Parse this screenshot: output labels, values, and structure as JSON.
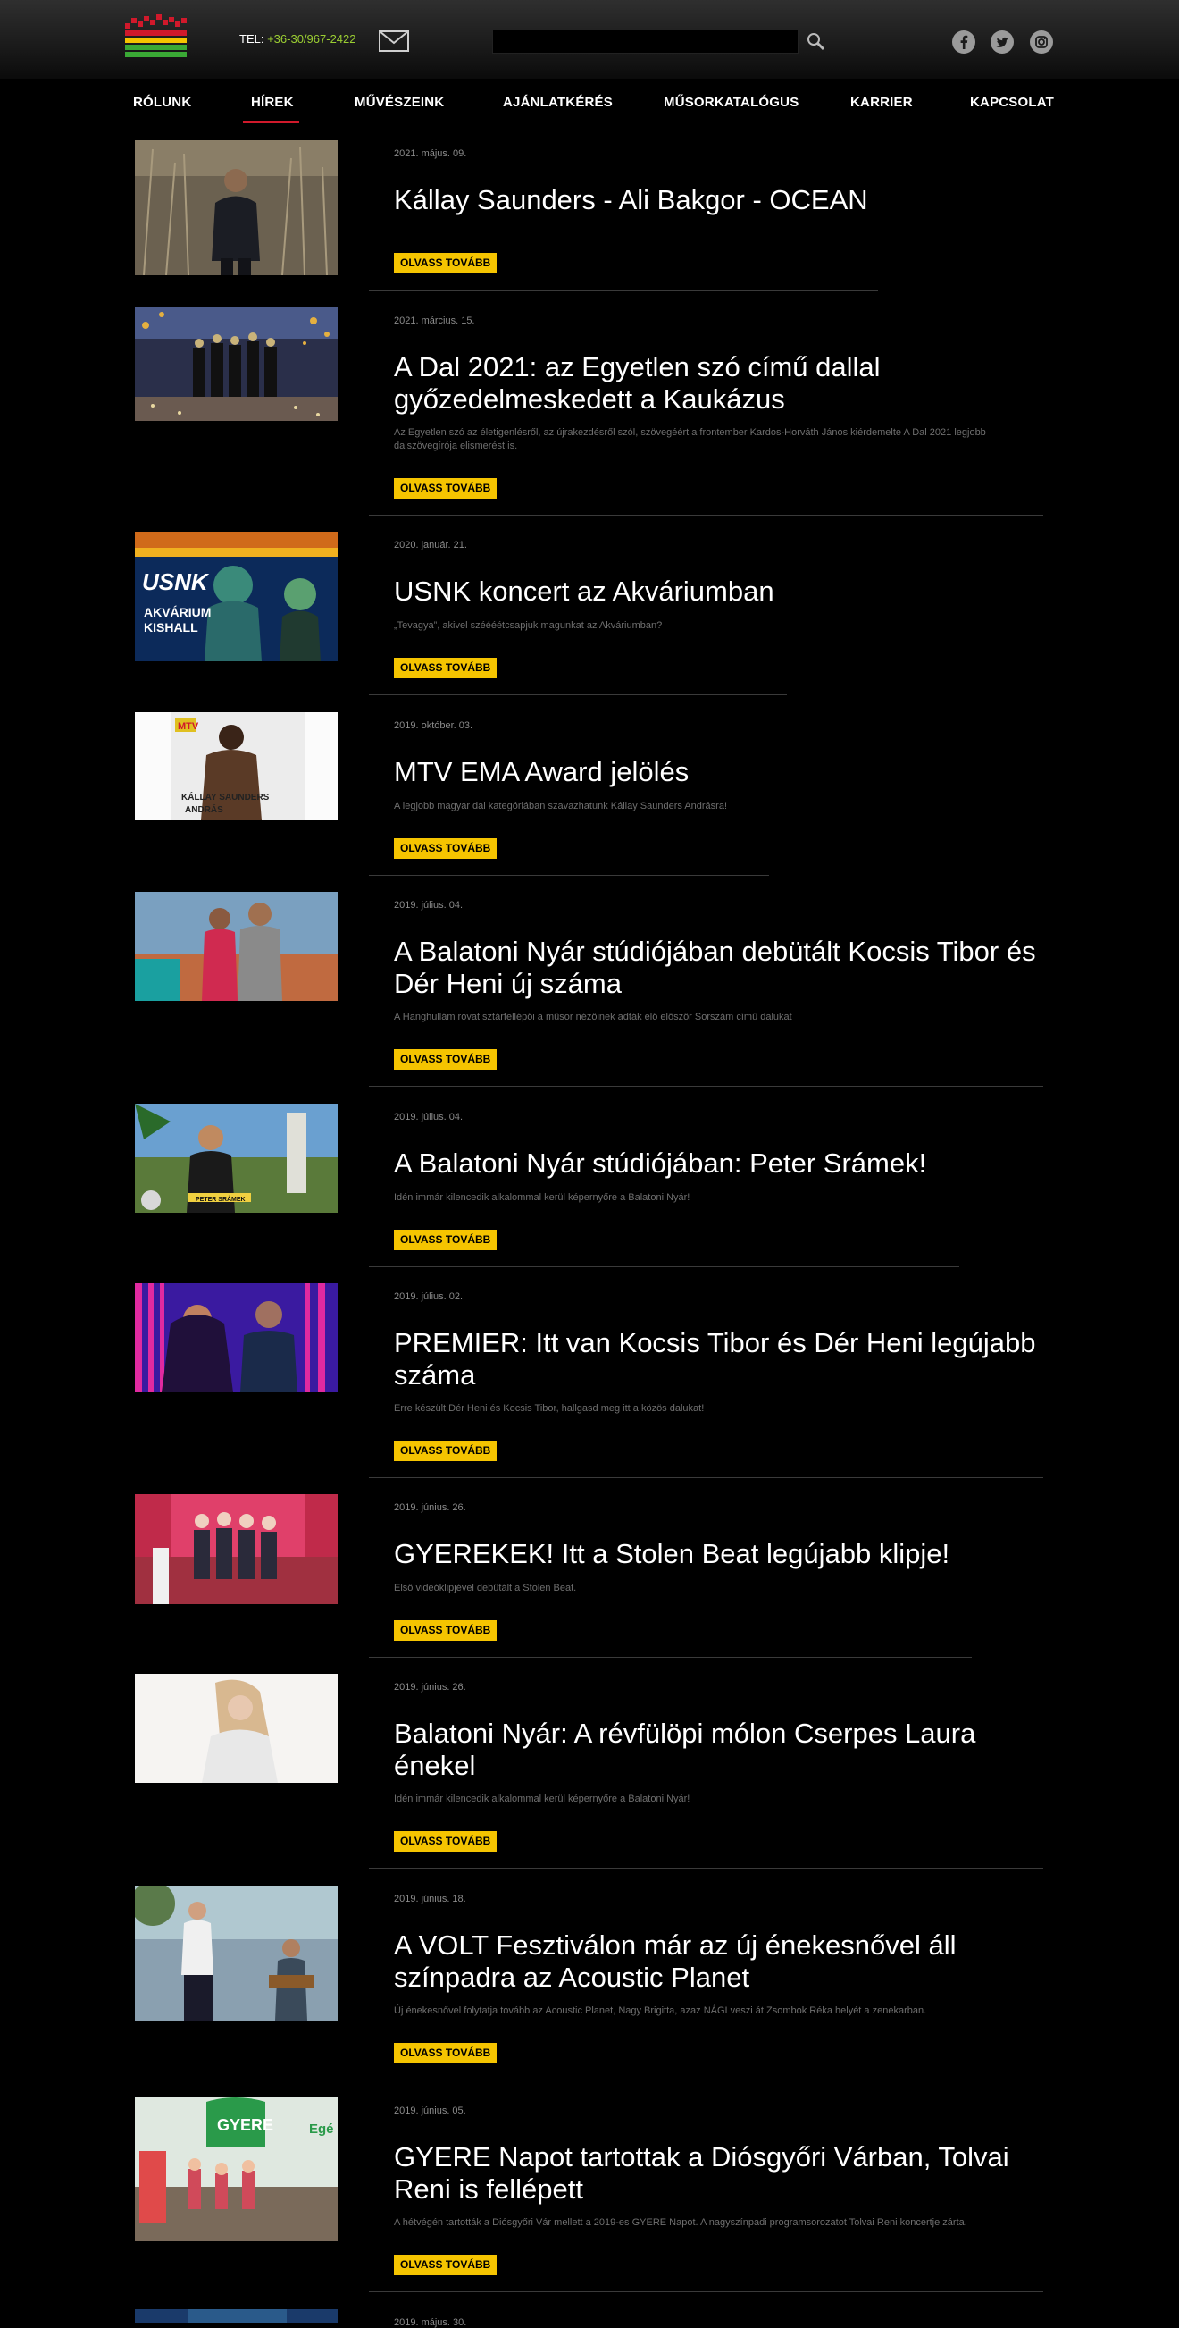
{
  "header": {
    "phone_label": "TEL:",
    "phone_number": "+36-30/967-2422",
    "search_value": ""
  },
  "nav": [
    "RÓLUNK",
    "HÍREK",
    "MŰVÉSZEINK",
    "AJÁNLATKÉRÉS",
    "MŰSORKATALÓGUS",
    "KARRIER",
    "KAPCSOLAT"
  ],
  "read_more": "OLVASS TOVÁBB",
  "colors": {
    "accent": "#f5c400",
    "nav_active": "#d0192b",
    "phone": "#9acd32"
  },
  "articles": [
    {
      "date": "2021. május. 09.",
      "title": "Kállay Saunders - Ali Bakgor - OCEAN",
      "excerpt": ""
    },
    {
      "date": "2021. március. 15.",
      "title": "A Dal 2021: az Egyetlen szó című dallal győzedelmeskedett a Kaukázus",
      "excerpt": "Az Egyetlen szó az életigenlésről, az újrakezdésről szól, szövegéért a frontember Kardos-Horváth János kiérdemelte A Dal 2021 legjobb dalszövegírója elismerést is."
    },
    {
      "date": "2020. január. 21.",
      "title": "USNK koncert az Akváriumban",
      "excerpt": "„Tevagya”, akivel széééétcsapjuk magunkat az Akváriumban?"
    },
    {
      "date": "2019. október. 03.",
      "title": "MTV EMA Award jelölés",
      "excerpt": "A legjobb magyar dal kategóriában szavazhatunk Kállay Saunders Andrásra!"
    },
    {
      "date": "2019. július. 04.",
      "title": "A Balatoni Nyár stúdiójában debütált Kocsis Tibor és Dér Heni új száma",
      "excerpt": "A Hanghullám rovat sztárfellépői a műsor nézőinek adták elő először Sorszám című dalukat"
    },
    {
      "date": "2019. július. 04.",
      "title": "A Balatoni Nyár stúdiójában: Peter Srámek!",
      "excerpt": "Idén immár kilencedik alkalommal kerül képernyőre a Balatoni Nyár!"
    },
    {
      "date": "2019. július. 02.",
      "title": "PREMIER: Itt van Kocsis Tibor és Dér Heni legújabb száma",
      "excerpt": "Erre készült Dér Heni és Kocsis Tibor, hallgasd meg itt a közös dalukat!"
    },
    {
      "date": "2019. június. 26.",
      "title": "GYEREKEK! Itt a Stolen Beat legújabb klipje!",
      "excerpt": "Első videóklipjével debütált a Stolen Beat."
    },
    {
      "date": "2019. június. 26.",
      "title": "Balatoni Nyár: A révfülöpi mólon Cserpes Laura énekel",
      "excerpt": "Idén immár kilencedik alkalommal kerül képernyőre a Balatoni Nyár!"
    },
    {
      "date": "2019. június. 18.",
      "title": "A VOLT Fesztiválon már az új énekesnővel áll színpadra az Acoustic Planet",
      "excerpt": "Új énekesnővel folytatja tovább az Acoustic Planet, Nagy Brigitta, azaz NÁGI veszi át Zsombok Réka helyét a zenekarban."
    },
    {
      "date": "2019. június. 05.",
      "title": "GYERE Napot tartottak a Diósgyőri Várban, Tolvai Reni is fellépett",
      "excerpt": "A hétvégén tartották a Diósgyőri Vár mellett a 2019-es GYERE Napot. A nagyszínpadi programsorozatot Tolvai Reni koncertje zárta."
    },
    {
      "date": "2019. május. 30.",
      "title": "",
      "excerpt": ""
    }
  ],
  "thumb_captions": {
    "usnk_1": "USNK",
    "usnk_2": "AKVÁRIUM",
    "usnk_3": "KISHALL",
    "mtv": "MTV",
    "mtv_name_1": "KÁLLAY SAUNDERS",
    "mtv_name_2": "ANDRÁS",
    "peter": "PETER SRÁMEK",
    "gyere": "GYERE",
    "gyere_2": "Egé"
  }
}
